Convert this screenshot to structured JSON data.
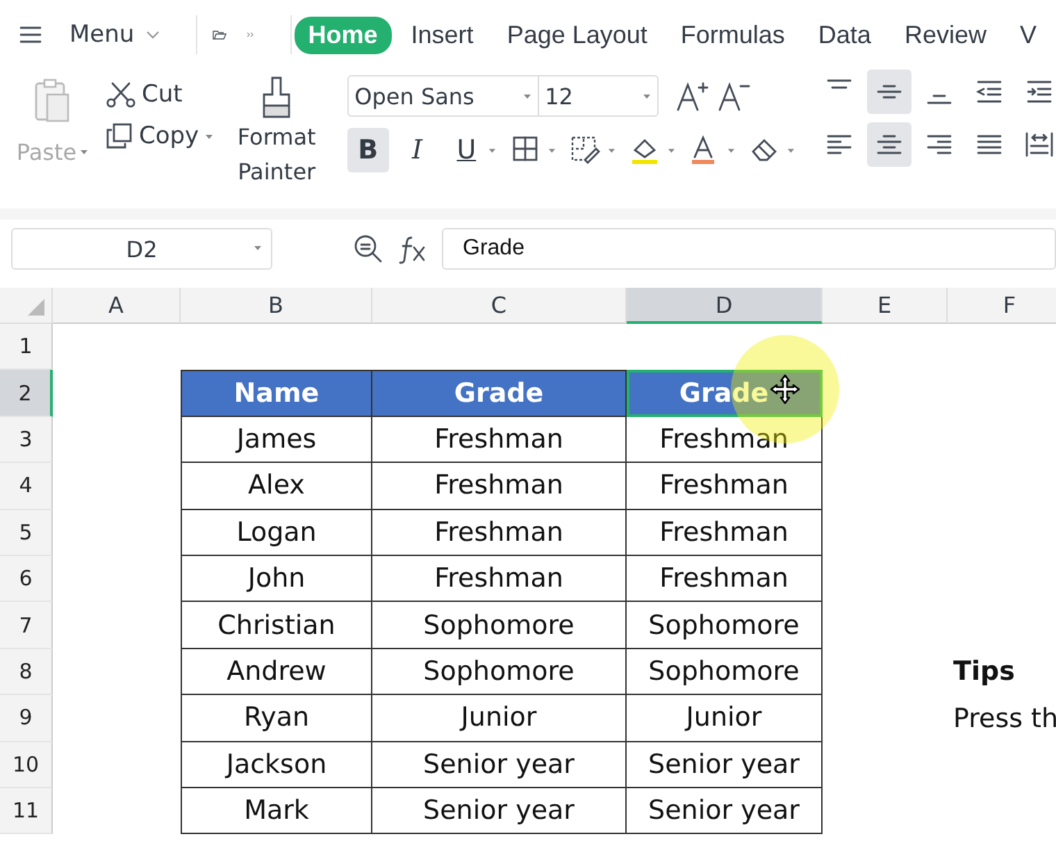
{
  "menu": {
    "label": "Menu"
  },
  "tabs": [
    {
      "label": "Home",
      "selected": true
    },
    {
      "label": "Insert",
      "selected": false
    },
    {
      "label": "Page Layout",
      "selected": false
    },
    {
      "label": "Formulas",
      "selected": false
    },
    {
      "label": "Data",
      "selected": false
    },
    {
      "label": "Review",
      "selected": false
    },
    {
      "label": "V",
      "selected": false
    }
  ],
  "clipboard": {
    "paste": {
      "label": "Paste",
      "disabled": true
    },
    "cut": "Cut",
    "copy": "Copy",
    "format_painter": "Format Painter"
  },
  "font": {
    "name": "Open Sans",
    "size": "12"
  },
  "format_buttons": [
    {
      "kind": "bold",
      "label": "B",
      "selected": true
    },
    {
      "kind": "italic",
      "label": "I",
      "selected": false
    },
    {
      "kind": "underline",
      "label": "U",
      "selected": false
    },
    {
      "kind": "borders",
      "selected": false
    },
    {
      "kind": "cell-format",
      "selected": false
    },
    {
      "kind": "fill",
      "selected": false
    },
    {
      "kind": "font-color",
      "selected": false
    },
    {
      "kind": "eraser",
      "selected": false
    }
  ],
  "align_buttons": [
    {
      "kind": "top",
      "selected": false
    },
    {
      "kind": "middle",
      "selected": true
    },
    {
      "kind": "bottom",
      "selected": false
    },
    {
      "kind": "outdent",
      "selected": false
    },
    {
      "kind": "indent",
      "selected": false
    },
    {
      "kind": "left",
      "selected": false
    },
    {
      "kind": "center",
      "selected": true
    },
    {
      "kind": "right",
      "selected": false
    },
    {
      "kind": "justify",
      "selected": false
    },
    {
      "kind": "distribute",
      "selected": false
    }
  ],
  "formula_bar": {
    "cell": "D2",
    "value": "Grade"
  },
  "columns": [
    {
      "label": "A",
      "selected": false
    },
    {
      "label": "B",
      "selected": false
    },
    {
      "label": "C",
      "selected": false
    },
    {
      "label": "D",
      "selected": true
    },
    {
      "label": "E",
      "selected": false
    },
    {
      "label": "F",
      "selected": false
    }
  ],
  "row_numbers": [
    {
      "label": "1",
      "selected": false
    },
    {
      "label": "2",
      "selected": true
    },
    {
      "label": "3",
      "selected": false
    },
    {
      "label": "4",
      "selected": false
    },
    {
      "label": "5",
      "selected": false
    },
    {
      "label": "6",
      "selected": false
    },
    {
      "label": "7",
      "selected": false
    },
    {
      "label": "8",
      "selected": false
    },
    {
      "label": "9",
      "selected": false
    },
    {
      "label": "10",
      "selected": false
    },
    {
      "label": "11",
      "selected": false
    }
  ],
  "table": {
    "header": [
      {
        "text": "Name",
        "selected": false
      },
      {
        "text": "Grade",
        "selected": false
      },
      {
        "text": "Grade",
        "selected": true
      }
    ],
    "rows": [
      [
        "James",
        "Freshman",
        "Freshman"
      ],
      [
        "Alex",
        "Freshman",
        "Freshman"
      ],
      [
        "Logan",
        "Freshman",
        "Freshman"
      ],
      [
        "John",
        "Freshman",
        "Freshman"
      ],
      [
        "Christian",
        "Sophomore",
        "Sophomore"
      ],
      [
        "Andrew",
        "Sophomore",
        "Sophomore"
      ],
      [
        "Ryan",
        "Junior",
        "Junior"
      ],
      [
        "Jackson",
        "Senior year",
        "Senior year"
      ],
      [
        "Mark",
        "Senior year",
        "Senior year"
      ]
    ]
  },
  "tips": {
    "title": "Tips",
    "text": "Press th"
  },
  "pointer": {
    "kind": "move"
  }
}
